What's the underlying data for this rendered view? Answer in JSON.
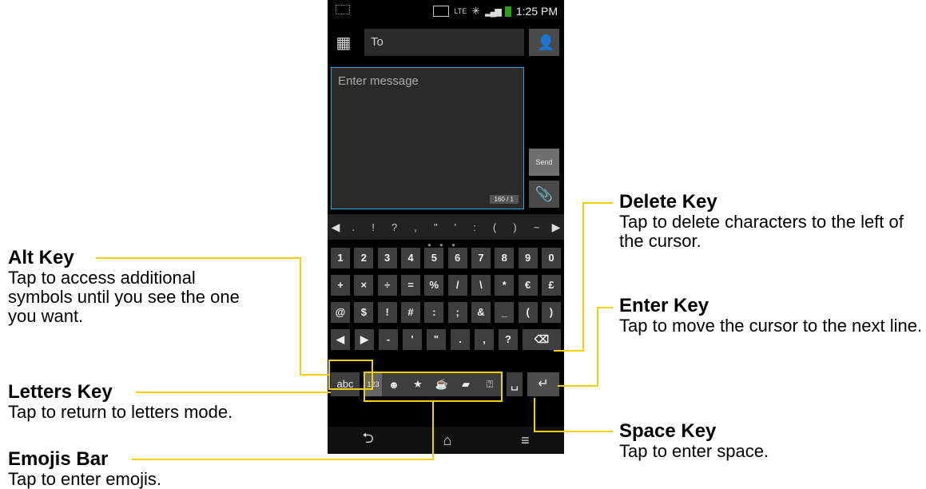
{
  "status_bar": {
    "network": "LTE",
    "time": "1:25 PM"
  },
  "compose": {
    "to_placeholder": "To",
    "message_placeholder": "Enter message",
    "counter": "160 / 1",
    "send_label": "Send"
  },
  "symbols_row": [
    ".",
    "!",
    "?",
    ",",
    "\"",
    "'",
    ":",
    "(",
    ")",
    "~"
  ],
  "keyboard": {
    "row1": [
      "1",
      "2",
      "3",
      "4",
      "5",
      "6",
      "7",
      "8",
      "9",
      "0"
    ],
    "row2": [
      "+",
      "×",
      "÷",
      "=",
      "%",
      "/",
      "\\",
      "*",
      "€",
      "£"
    ],
    "row3": [
      "@",
      "$",
      "!",
      "#",
      ":",
      ";",
      "&",
      "_",
      "(",
      ")"
    ],
    "row4": [
      "-",
      "'",
      "\"",
      ".",
      ",",
      "?"
    ],
    "abc_label": "abc",
    "k123_label": "123"
  },
  "callouts": {
    "alt_key": {
      "title": "Alt Key",
      "desc": "Tap to access additional symbols until you see the one you want."
    },
    "letters_key": {
      "title": "Letters Key",
      "desc": "Tap to return to letters mode."
    },
    "emojis_bar": {
      "title": "Emojis Bar",
      "desc": "Tap to enter emojis."
    },
    "delete_key": {
      "title": "Delete Key",
      "desc": "Tap to delete characters to the left of the cursor."
    },
    "enter_key": {
      "title": "Enter Key",
      "desc": "Tap to move the cursor to the next line."
    },
    "space_key": {
      "title": "Space Key",
      "desc": "Tap to enter space."
    }
  },
  "colors": {
    "callout_line": "#f5d000",
    "msg_border": "#3aa4d8"
  }
}
